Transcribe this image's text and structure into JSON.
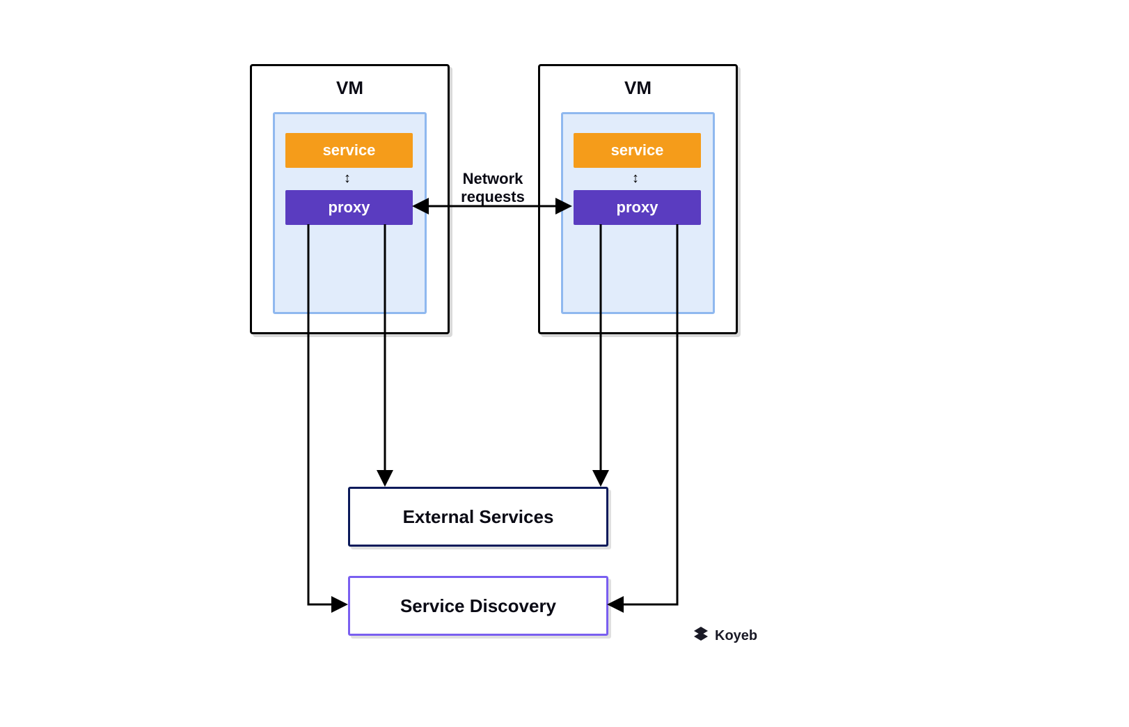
{
  "vm1": {
    "title": "VM",
    "service_label": "service",
    "proxy_label": "proxy"
  },
  "vm2": {
    "title": "VM",
    "service_label": "service",
    "proxy_label": "proxy"
  },
  "network_label_line1": "Network",
  "network_label_line2": "requests",
  "external_services_label": "External Services",
  "service_discovery_label": "Service Discovery",
  "brand_name": "Koyeb",
  "colors": {
    "vm_border": "#000000",
    "inner_fill": "#e1ecfb",
    "inner_border": "#8fb8ef",
    "service_fill": "#f59c1a",
    "proxy_fill": "#5a3cc0",
    "ext_border": "#0b1a5a",
    "sd_border": "#7a5ff0"
  }
}
